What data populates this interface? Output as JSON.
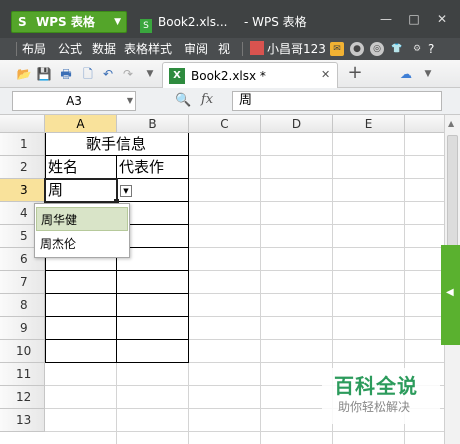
{
  "titlebar": {
    "app_label": "WPS 表格",
    "app_logo": "S",
    "doc_tab": "Book2.xls...",
    "title": "- WPS 表格",
    "min": "—",
    "max": "□",
    "close": "✕"
  },
  "ribbon": {
    "tabs": [
      "布局",
      "公式",
      "数据",
      "表格样式",
      "审阅",
      "视"
    ],
    "user": "小昌哥123",
    "help": "?"
  },
  "qat": {
    "file_tab": "Book2.xlsx *",
    "file_close": "✕",
    "new_tab": "+"
  },
  "formula_bar": {
    "cell_ref": "A3",
    "fx": "fx",
    "value": "周"
  },
  "grid": {
    "columns": [
      "A",
      "B",
      "C",
      "D",
      "E"
    ],
    "rows": [
      "1",
      "2",
      "3",
      "4",
      "5",
      "6",
      "7",
      "8",
      "9",
      "10",
      "11",
      "12",
      "13"
    ],
    "title_cell": "歌手信息",
    "header_a": "姓名",
    "header_b": "代表作",
    "active_value": "周"
  },
  "dropdown": {
    "items": [
      "周华健",
      "周杰伦"
    ]
  },
  "watermark": {
    "title": "百科全说",
    "subtitle": "助你轻松解决"
  },
  "colors": {
    "accent_green": "#54a52a",
    "selected_header": "#f9e29b",
    "dropdown_highlight": "#d9e4c8"
  }
}
